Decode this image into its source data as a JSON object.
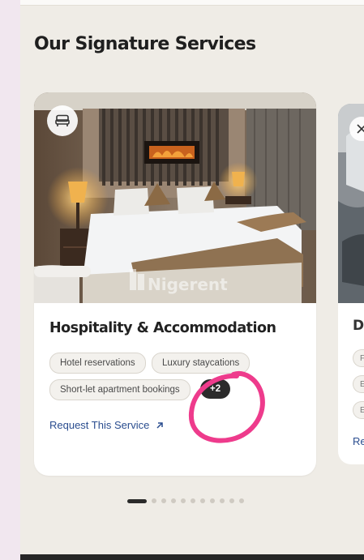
{
  "section": {
    "title": "Our Signature Services"
  },
  "services": [
    {
      "title": "Hospitality & Accommodation",
      "icon": "bed-icon",
      "image_watermark": "Nigerent",
      "tags": [
        "Hotel reservations",
        "Luxury staycations",
        "Short-let apartment bookings"
      ],
      "more_count": "+2",
      "link_label": "Request This Service"
    },
    {
      "title_peek": "D",
      "icon": "utensils-icon",
      "tag_peeks": [
        "F",
        "E",
        "E"
      ],
      "link_peek": "Re"
    }
  ],
  "carousel": {
    "total_slides": 11,
    "active_index": 0
  },
  "colors": {
    "accent_link": "#2a4d8f",
    "annotation": "#ee3b8c",
    "more_badge": "#2b2b2b",
    "page_bg": "#efece6"
  }
}
